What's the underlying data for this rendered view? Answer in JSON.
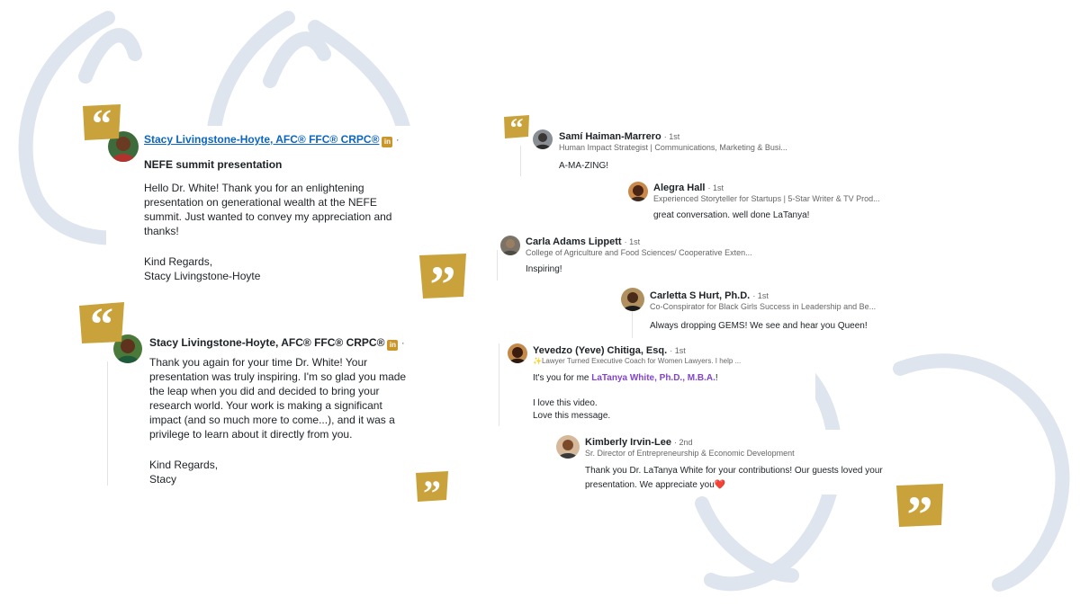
{
  "colors": {
    "quote_gold": "#c9a23c",
    "bg_quote": "#dfe5ee",
    "link_blue": "#0a66c2",
    "mention_purple": "#8344cc"
  },
  "message_1": {
    "sender": "Stacy Livingstone-Hoyte, AFC® FFC® CRPC®",
    "subject": "NEFE summit presentation",
    "lines": [
      "Hello Dr. White! Thank you for an enlightening",
      "presentation on generational wealth at the NEFE",
      "summit. Just wanted to convey my appreciation and",
      "thanks!",
      "Kind Regards,",
      "Stacy Livingstone-Hoyte"
    ]
  },
  "message_2": {
    "sender": "Stacy Livingstone-Hoyte, AFC® FFC® CRPC®",
    "lines": [
      "Thank you again for your time Dr. White! Your",
      "presentation was truly inspiring. I'm so glad you made",
      "the leap when you did and decided to bring your",
      "research world. Your work is making a significant",
      "impact (and so much more to come...), and it was a",
      "privilege to learn about it directly from you.",
      "Kind Regards,",
      "Stacy"
    ]
  },
  "comments": [
    {
      "name": "Samí Haiman-Marrero",
      "degree": "· 1st",
      "headline": "Human Impact Strategist | Communications, Marketing & Busi...",
      "text": "A-MA-ZING!"
    },
    {
      "name": "Alegra Hall",
      "degree": "· 1st",
      "headline": "Experienced Storyteller for Startups | 5-Star Writer & TV Prod...",
      "text": "great conversation. well done LaTanya!"
    },
    {
      "name": "Carla Adams Lippett",
      "degree": "· 1st",
      "headline": "College of Agriculture and Food Sciences/ Cooperative Exten...",
      "text": "Inspiring!"
    },
    {
      "name": "Carletta S Hurt, Ph.D.",
      "degree": "· 1st",
      "headline": "Co-Conspirator for Black Girls Success in Leadership and Be...",
      "text": "Always dropping GEMS! We see and hear you Queen!"
    },
    {
      "name": "Yevedzo (Yeve) Chitiga, Esq.",
      "degree": "· 1st",
      "headline": "✨Lawyer Turned Executive Coach for Women Lawyers. I help ...",
      "text_pre": "It's you for me ",
      "mention": "LaTanya White, Ph.D., M.B.A.",
      "text_post": "!",
      "line2": "I love this video.",
      "line3": "Love this message."
    },
    {
      "name": "Kimberly Irvin-Lee",
      "degree": "· 2nd",
      "headline": "Sr. Director of Entrepreneurship & Economic Development",
      "line1": "Thank you Dr. LaTanya White for your contributions! Our guests loved your",
      "line2": "presentation. We appreciate you❤️"
    }
  ]
}
